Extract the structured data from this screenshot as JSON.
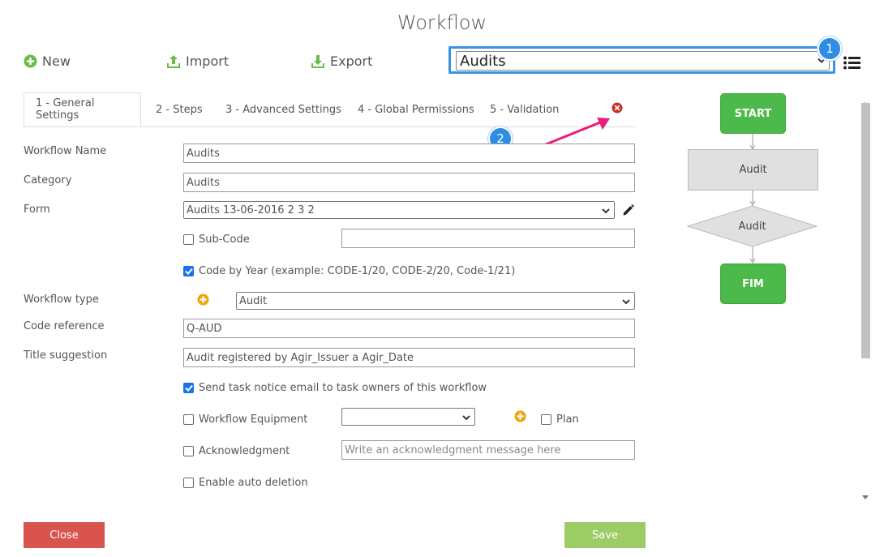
{
  "window": {
    "title": "Workflow"
  },
  "toolbar": {
    "new_label": "New",
    "import_label": "Import",
    "export_label": "Export",
    "workflow_selected": "Audits"
  },
  "annotations": {
    "badge1": "1",
    "badge2": "2"
  },
  "tabs": [
    {
      "label": "1 - General Settings"
    },
    {
      "label": "2 - Steps"
    },
    {
      "label": "3 - Advanced Settings"
    },
    {
      "label": "4 - Global Permissions"
    },
    {
      "label": "5 - Validation"
    }
  ],
  "form": {
    "workflow_name_label": "Workflow Name",
    "workflow_name_value": "Audits",
    "category_label": "Category",
    "category_value": "Audits",
    "form_label": "Form",
    "form_value": "Audits 13-06-2016 2 3 2",
    "subcode_label": "Sub-Code",
    "subcode_value": "",
    "code_by_year_label": "Code by Year (example: CODE-1/20, CODE-2/20, Code-1/21)",
    "workflow_type_label": "Workflow type",
    "workflow_type_value": "Audit",
    "code_reference_label": "Code reference",
    "code_reference_value": "Q-AUD",
    "title_suggestion_label": "Title suggestion",
    "title_suggestion_value": "Audit registered by Agir_Issuer a Agir_Date",
    "send_task_notice_label": "Send task notice email to task owners of this workflow",
    "workflow_equipment_label": "Workflow Equipment",
    "workflow_equipment_value": "",
    "plan_label": "Plan",
    "acknowledgment_label": "Acknowledgment",
    "acknowledgment_placeholder": "Write an acknowledgment message here",
    "auto_deletion_label": "Enable auto deletion"
  },
  "checkboxes": {
    "subcode": false,
    "code_by_year": true,
    "send_task_notice": true,
    "workflow_equipment": false,
    "plan": false,
    "acknowledgment": false,
    "auto_deletion": false
  },
  "flowchart": {
    "start": "START",
    "step": "Audit",
    "decision": "Audit",
    "end": "FIM"
  },
  "footer": {
    "close_label": "Close",
    "save_label": "Save"
  },
  "colors": {
    "accent_blue": "#3a93e2",
    "flow_green": "#4cba4a",
    "close_red": "#d9534f",
    "save_green": "#9ccc65",
    "annotation_arrow": "#ee1b7a",
    "add_orange": "#f0a30a"
  }
}
